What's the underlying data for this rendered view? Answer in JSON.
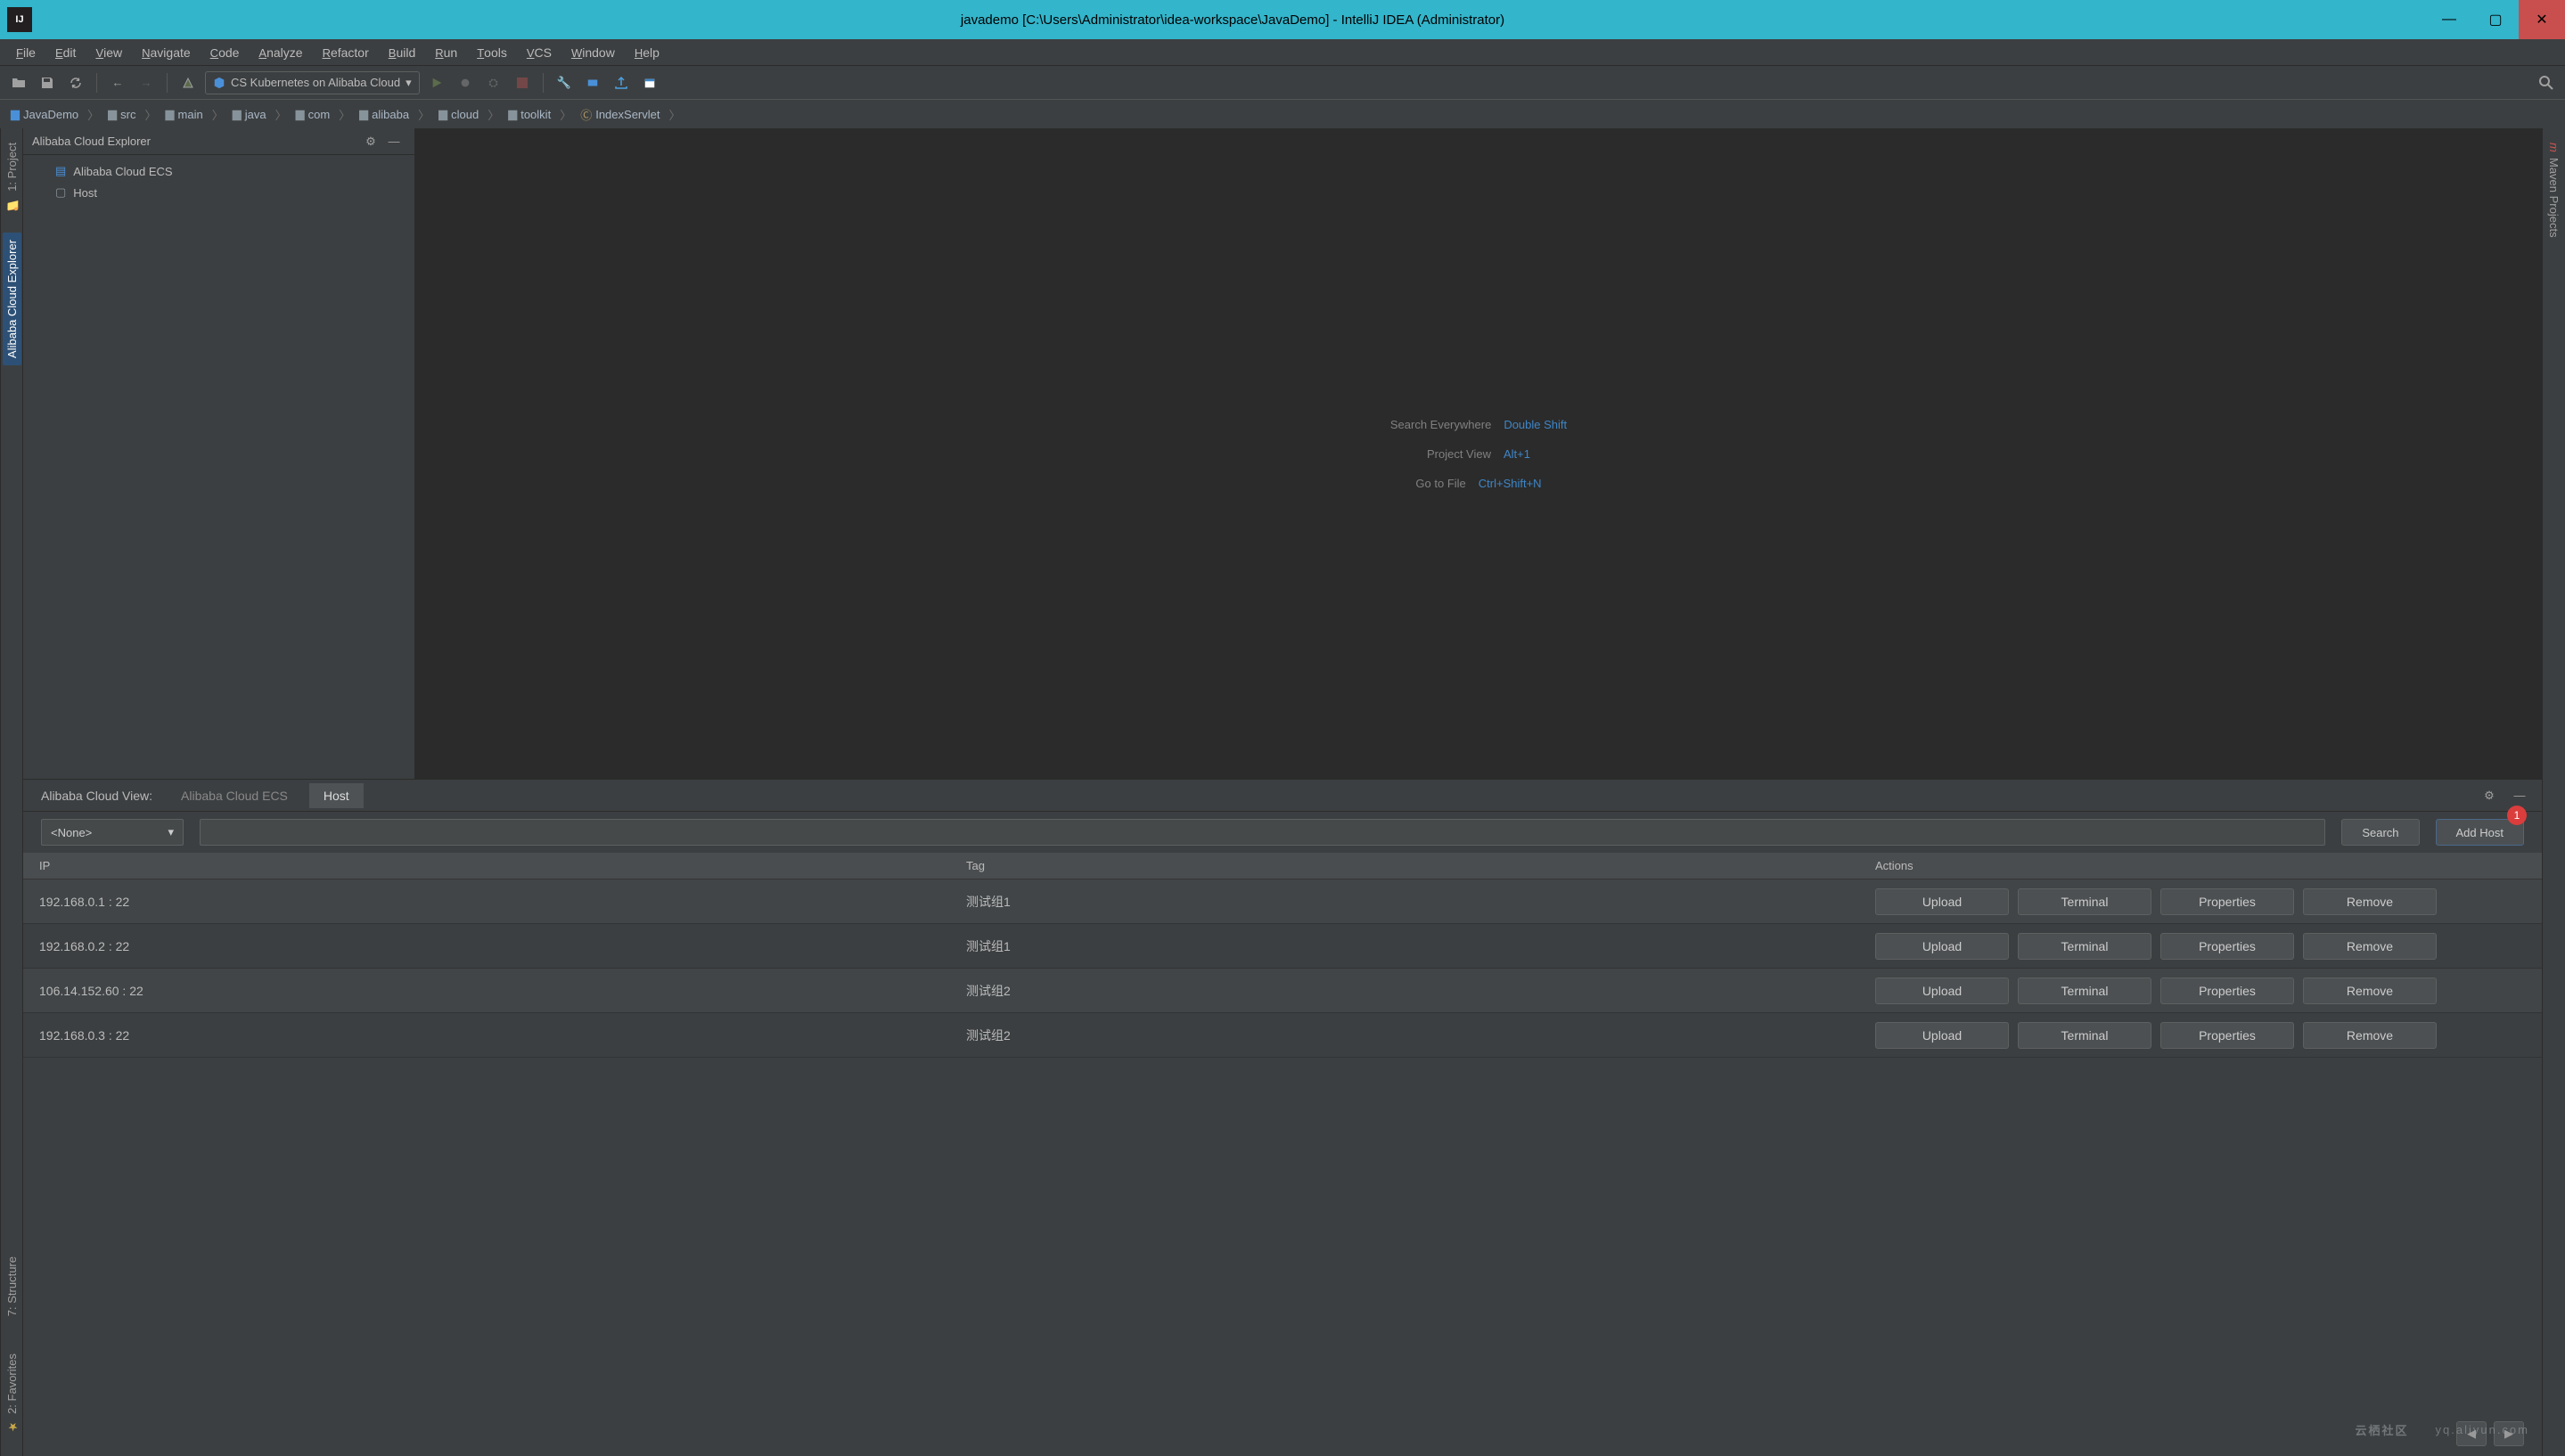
{
  "window": {
    "title": "javademo [C:\\Users\\Administrator\\idea-workspace\\JavaDemo] - IntelliJ IDEA (Administrator)"
  },
  "menu": [
    "File",
    "Edit",
    "View",
    "Navigate",
    "Code",
    "Analyze",
    "Refactor",
    "Build",
    "Run",
    "Tools",
    "VCS",
    "Window",
    "Help"
  ],
  "run_config": "CS Kubernetes on Alibaba Cloud",
  "breadcrumbs": [
    "JavaDemo",
    "src",
    "main",
    "java",
    "com",
    "alibaba",
    "cloud",
    "toolkit",
    "IndexServlet"
  ],
  "side_panel": {
    "title": "Alibaba Cloud Explorer",
    "nodes": [
      "Alibaba Cloud ECS",
      "Host"
    ]
  },
  "left_gutter": {
    "project": "1: Project",
    "explorer": "Alibaba Cloud Explorer"
  },
  "right_gutter": {
    "maven": "Maven Projects"
  },
  "bl_gutter": {
    "structure": "7: Structure",
    "favorites": "2: Favorites"
  },
  "editor_hints": [
    {
      "label": "Search Everywhere",
      "key": "Double Shift"
    },
    {
      "label": "Project View",
      "key": "Alt+1"
    },
    {
      "label": "Go to File",
      "key": "Ctrl+Shift+N"
    }
  ],
  "bottom": {
    "title": "Alibaba Cloud View:",
    "tabs": [
      "Alibaba Cloud ECS",
      "Host"
    ],
    "active_tab": "Host",
    "filter": "<None>",
    "search_btn": "Search",
    "add_host_btn": "Add Host",
    "badge": "1",
    "columns": [
      "IP",
      "Tag",
      "Actions"
    ],
    "action_labels": [
      "Upload",
      "Terminal",
      "Properties",
      "Remove"
    ],
    "rows": [
      {
        "ip": "192.168.0.1 : 22",
        "tag": "测试组1"
      },
      {
        "ip": "192.168.0.2 : 22",
        "tag": "测试组1"
      },
      {
        "ip": "106.14.152.60 : 22",
        "tag": "测试组2"
      },
      {
        "ip": "192.168.0.3 : 22",
        "tag": "测试组2"
      }
    ]
  },
  "watermark": {
    "cn": "云栖社区",
    "en": "yq.aliyun.com"
  }
}
